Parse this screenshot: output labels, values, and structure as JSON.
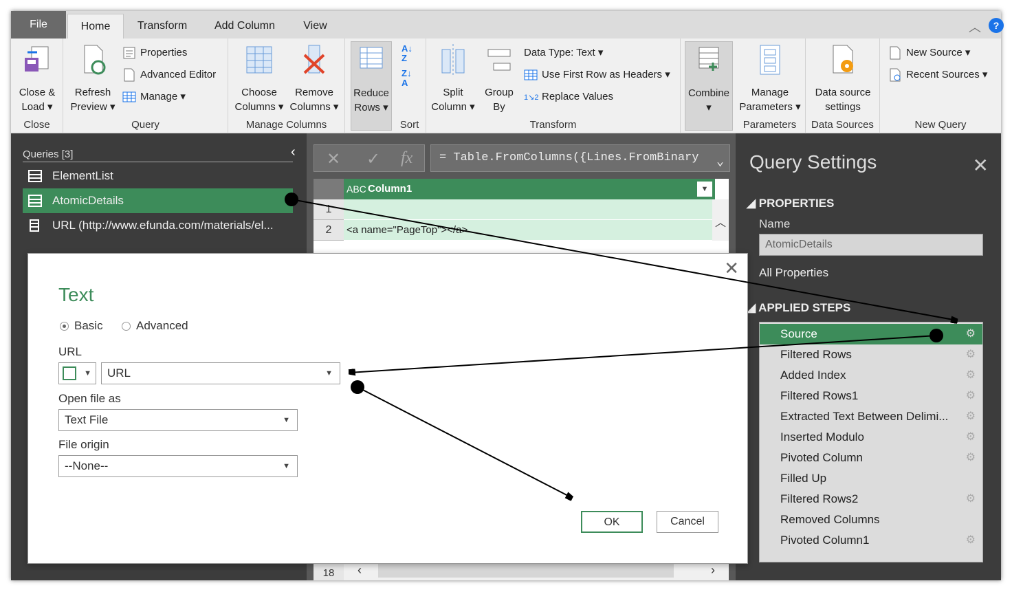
{
  "tabs": [
    "File",
    "Home",
    "Transform",
    "Add Column",
    "View"
  ],
  "help_label": "?",
  "ribbon": {
    "close": {
      "button": "Close & Load",
      "button_l1": "Close &",
      "button_l2": "Load",
      "label": "Close"
    },
    "query": {
      "refresh_l1": "Refresh",
      "refresh_l2": "Preview",
      "properties": "Properties",
      "advanced_editor": "Advanced Editor",
      "manage": "Manage",
      "label": "Query"
    },
    "manage_columns": {
      "choose_l1": "Choose",
      "choose_l2": "Columns",
      "remove_l1": "Remove",
      "remove_l2": "Columns",
      "label": "Manage Columns"
    },
    "reduce_rows": {
      "l1": "Reduce",
      "l2": "Rows"
    },
    "sort": {
      "label": "Sort"
    },
    "transform": {
      "split_l1": "Split",
      "split_l2": "Column",
      "group_l1": "Group",
      "group_l2": "By",
      "data_type": "Data Type: Text",
      "first_row": "Use First Row as Headers",
      "replace": "Replace Values",
      "label": "Transform"
    },
    "combine": {
      "label": "Combine"
    },
    "parameters": {
      "l1": "Manage",
      "l2": "Parameters",
      "label": "Parameters"
    },
    "data_sources": {
      "l1": "Data source",
      "l2": "settings",
      "label": "Data Sources"
    },
    "new_query": {
      "new_source": "New Source",
      "recent_sources": "Recent Sources",
      "label": "New Query"
    }
  },
  "queries": {
    "title": "Queries [3]",
    "items": [
      "ElementList",
      "AtomicDetails",
      "URL (http://www.efunda.com/materials/el..."
    ]
  },
  "formula": {
    "text": "= Table.FromColumns({Lines.FromBinary",
    "fx": "fx"
  },
  "grid": {
    "column_type": "ABC",
    "column_name": "Column1",
    "rows": [
      {
        "n": "1",
        "v": ""
      },
      {
        "n": "2",
        "v": "<a name=\"PageTop\"></a>"
      }
    ],
    "last_row": "18"
  },
  "settings": {
    "title": "Query Settings",
    "properties": "PROPERTIES",
    "name_label": "Name",
    "name_value": "AtomicDetails",
    "all_properties": "All Properties",
    "applied_steps": "APPLIED STEPS",
    "steps": [
      {
        "label": "Source",
        "gear": true
      },
      {
        "label": "Filtered Rows",
        "gear": true
      },
      {
        "label": "Added Index",
        "gear": true
      },
      {
        "label": "Filtered Rows1",
        "gear": true
      },
      {
        "label": "Extracted Text Between Delimi...",
        "gear": true
      },
      {
        "label": "Inserted Modulo",
        "gear": true
      },
      {
        "label": "Pivoted Column",
        "gear": true
      },
      {
        "label": "Filled Up",
        "gear": false
      },
      {
        "label": "Filtered Rows2",
        "gear": true
      },
      {
        "label": "Removed Columns",
        "gear": false
      },
      {
        "label": "Pivoted Column1",
        "gear": true
      }
    ]
  },
  "dialog": {
    "title": "Text",
    "basic": "Basic",
    "advanced": "Advanced",
    "url_label": "URL",
    "url_value": "URL",
    "open_as_label": "Open file as",
    "open_as_value": "Text File",
    "origin_label": "File origin",
    "origin_value": "--None--",
    "ok": "OK",
    "cancel": "Cancel"
  },
  "colors": {
    "accent": "#3d8c5a",
    "pane": "#3c3c3c",
    "grid_row": "#d5f0df"
  }
}
